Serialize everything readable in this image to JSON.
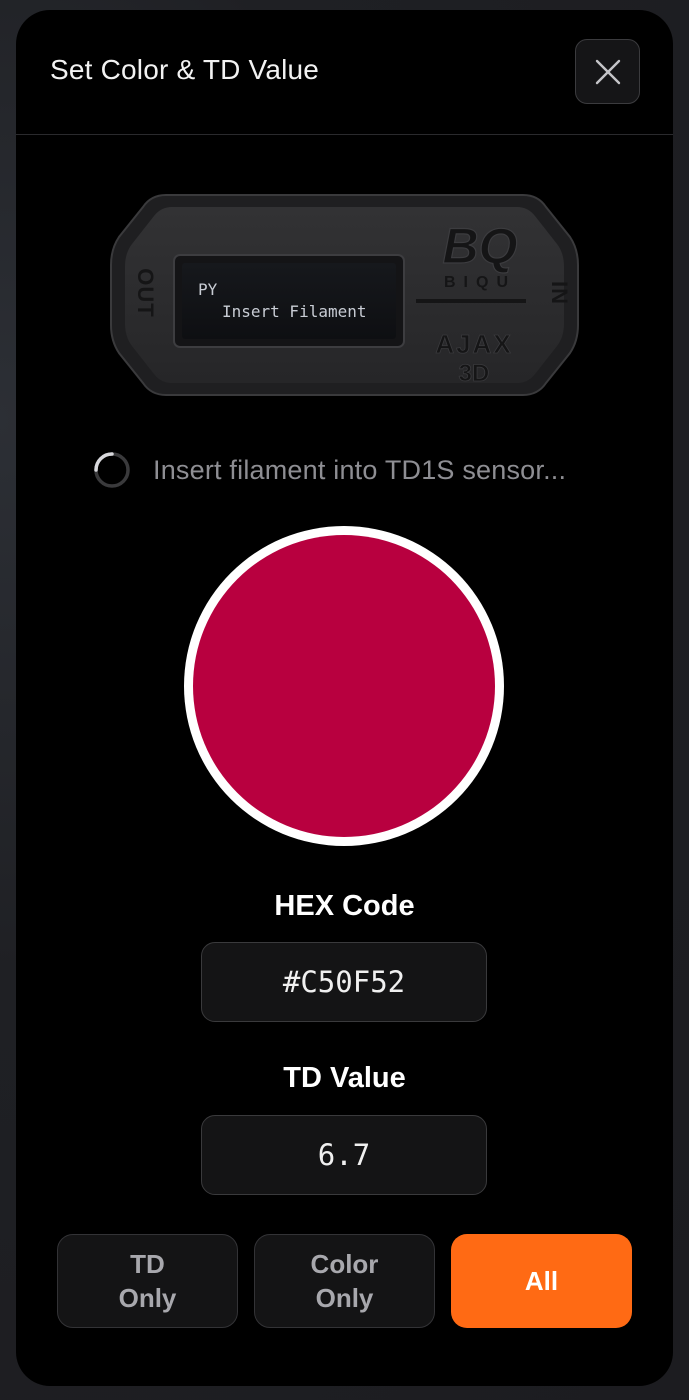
{
  "dialog": {
    "title": "Set Color & TD Value",
    "close_icon": "close-icon"
  },
  "device": {
    "left_port": "OUT",
    "right_port": "IN",
    "screen_line1": "PY",
    "screen_line2": "Insert Filament",
    "brand_logo": "BQ",
    "brand_name": "BIQU",
    "product_line1": "AJAX",
    "product_line2": "3D"
  },
  "status": {
    "icon": "spinner-icon",
    "text": "Insert filament into TD1S sensor..."
  },
  "color": {
    "swatch_hex": "#B8003F"
  },
  "hex_field": {
    "label": "HEX Code",
    "value": "#C50F52"
  },
  "td_field": {
    "label": "TD Value",
    "value": "6.7"
  },
  "actions": {
    "td_only": "TD\nOnly",
    "color_only": "Color\nOnly",
    "all": "All",
    "accent": "#FF6A14"
  }
}
